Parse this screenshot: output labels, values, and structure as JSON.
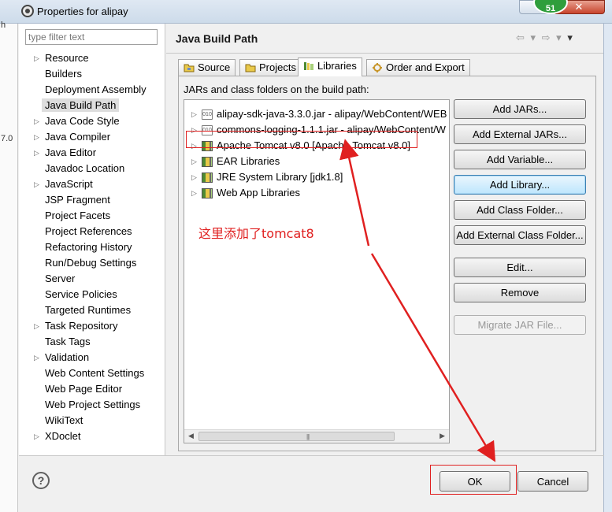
{
  "window": {
    "title": "Properties for alipay",
    "badge_count": "51",
    "close_glyph": "✕"
  },
  "outside_fragments": [
    "h",
    "7.0"
  ],
  "filter": {
    "placeholder": "type filter text",
    "value": ""
  },
  "nav": {
    "items": [
      {
        "label": "Resource",
        "expandable": true
      },
      {
        "label": "Builders",
        "expandable": false
      },
      {
        "label": "Deployment Assembly",
        "expandable": false
      },
      {
        "label": "Java Build Path",
        "expandable": false,
        "selected": true
      },
      {
        "label": "Java Code Style",
        "expandable": true
      },
      {
        "label": "Java Compiler",
        "expandable": true
      },
      {
        "label": "Java Editor",
        "expandable": true
      },
      {
        "label": "Javadoc Location",
        "expandable": false
      },
      {
        "label": "JavaScript",
        "expandable": true
      },
      {
        "label": "JSP Fragment",
        "expandable": false
      },
      {
        "label": "Project Facets",
        "expandable": false
      },
      {
        "label": "Project References",
        "expandable": false
      },
      {
        "label": "Refactoring History",
        "expandable": false
      },
      {
        "label": "Run/Debug Settings",
        "expandable": false
      },
      {
        "label": "Server",
        "expandable": false
      },
      {
        "label": "Service Policies",
        "expandable": false
      },
      {
        "label": "Targeted Runtimes",
        "expandable": false
      },
      {
        "label": "Task Repository",
        "expandable": true
      },
      {
        "label": "Task Tags",
        "expandable": false
      },
      {
        "label": "Validation",
        "expandable": true
      },
      {
        "label": "Web Content Settings",
        "expandable": false
      },
      {
        "label": "Web Page Editor",
        "expandable": false
      },
      {
        "label": "Web Project Settings",
        "expandable": false
      },
      {
        "label": "WikiText",
        "expandable": false
      },
      {
        "label": "XDoclet",
        "expandable": true
      }
    ]
  },
  "page": {
    "title": "Java Build Path",
    "history_back": "⇦ ▾",
    "history_forward": "⇨ ▾",
    "menu": "▾"
  },
  "tabs": [
    {
      "label": "Source",
      "icon": "source-folder-icon",
      "active": false
    },
    {
      "label": "Projects",
      "icon": "projects-icon",
      "active": false
    },
    {
      "label": "Libraries",
      "icon": "libraries-icon",
      "active": true
    },
    {
      "label": "Order and Export",
      "icon": "order-export-icon",
      "active": false
    }
  ],
  "libraries": {
    "label": "JARs and class folders on the build path:",
    "entries": [
      {
        "label": "alipay-sdk-java-3.3.0.jar - alipay/WebContent/WEB",
        "icon": "jar-icon"
      },
      {
        "label": "commons-logging-1.1.1.jar - alipay/WebContent/W",
        "icon": "jar-icon"
      },
      {
        "label": "Apache Tomcat v8.0 [Apache Tomcat v8.0]",
        "icon": "library-icon"
      },
      {
        "label": "EAR Libraries",
        "icon": "library-icon"
      },
      {
        "label": "JRE System Library [jdk1.8]",
        "icon": "library-icon"
      },
      {
        "label": "Web App Libraries",
        "icon": "library-icon"
      }
    ],
    "jar_icon_text": "010"
  },
  "buttons": {
    "add_jars": "Add JARs...",
    "add_external_jars": "Add External JARs...",
    "add_variable": "Add Variable...",
    "add_library": "Add Library...",
    "add_class_folder": "Add Class Folder...",
    "add_external_class_folder": "Add External Class Folder...",
    "edit": "Edit...",
    "remove": "Remove",
    "migrate_jar": "Migrate JAR File..."
  },
  "footer": {
    "help": "?",
    "ok": "OK",
    "cancel": "Cancel"
  },
  "annotation": {
    "note": "这里添加了tomcat8",
    "color": "#e02020"
  }
}
